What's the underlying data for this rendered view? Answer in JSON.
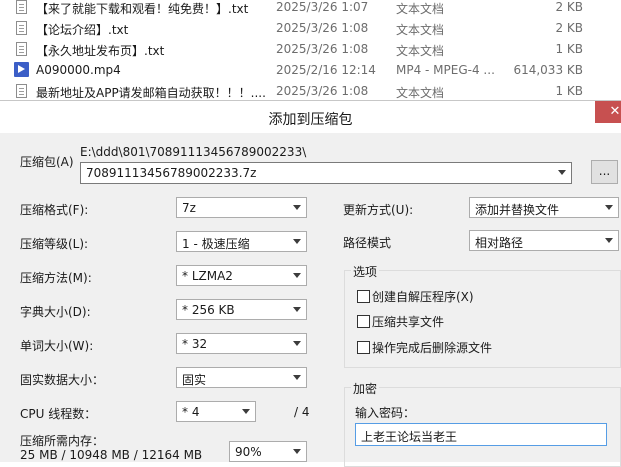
{
  "files": [
    {
      "name": "【来了就能下载和观看！纯免费！】.txt",
      "date": "2025/3/26 1:07",
      "type": "文本文档",
      "size": "2 KB",
      "icon": "txt-file-icon"
    },
    {
      "name": "【论坛介绍】.txt",
      "date": "2025/3/26 1:08",
      "type": "文本文档",
      "size": "2 KB",
      "icon": "txt-file-icon"
    },
    {
      "name": "【永久地址发布页】.txt",
      "date": "2025/3/26 1:08",
      "type": "文本文档",
      "size": "1 KB",
      "icon": "txt-file-icon"
    },
    {
      "name": "A090000.mp4",
      "date": "2025/2/16 12:14",
      "type": "MP4 - MPEG-4 ...",
      "size": "614,033 KB",
      "icon": "mp4-file-icon"
    },
    {
      "name": "最新地址及APP请发邮箱自动获取！！！....",
      "date": "2025/3/26 1:08",
      "type": "文本文档",
      "size": "1 KB",
      "icon": "txt-file-icon"
    }
  ],
  "dialog": {
    "title": "添加到压缩包",
    "close_glyph": "✕",
    "archive_label": "压缩包(A)",
    "archive_path": "E:\\ddd\\801\\70891113456789002233\\",
    "archive_name": "70891113456789002233.7z",
    "browse_label": "...",
    "format_label": "压缩格式(F):",
    "format_value": "7z",
    "level_label": "压缩等级(L):",
    "level_value": "1 - 极速压缩",
    "method_label": "压缩方法(M):",
    "method_value": "* LZMA2",
    "dict_label": "字典大小(D):",
    "dict_value": "* 256 KB",
    "word_label": "单词大小(W):",
    "word_value": "* 32",
    "solid_label": "固实数据大小：",
    "solid_value": "固实",
    "cpu_label": "CPU 线程数：",
    "cpu_value": "* 4",
    "cpu_total": "/ 4",
    "memory_label": "压缩所需内存：",
    "memory_value": "25 MB / 10948 MB / 12164 MB",
    "memory_percent": "90%",
    "update_label": "更新方式(U):",
    "update_value": "添加并替换文件",
    "path_label": "路径模式",
    "path_value": "相对路径",
    "options_group": "选项",
    "opt_sfx": "创建自解压程序(X)",
    "opt_shared": "压缩共享文件",
    "opt_delete": "操作完成后删除源文件",
    "encrypt_group": "加密",
    "password_label": "输入密码：",
    "password_value": "上老王论坛当老王"
  }
}
